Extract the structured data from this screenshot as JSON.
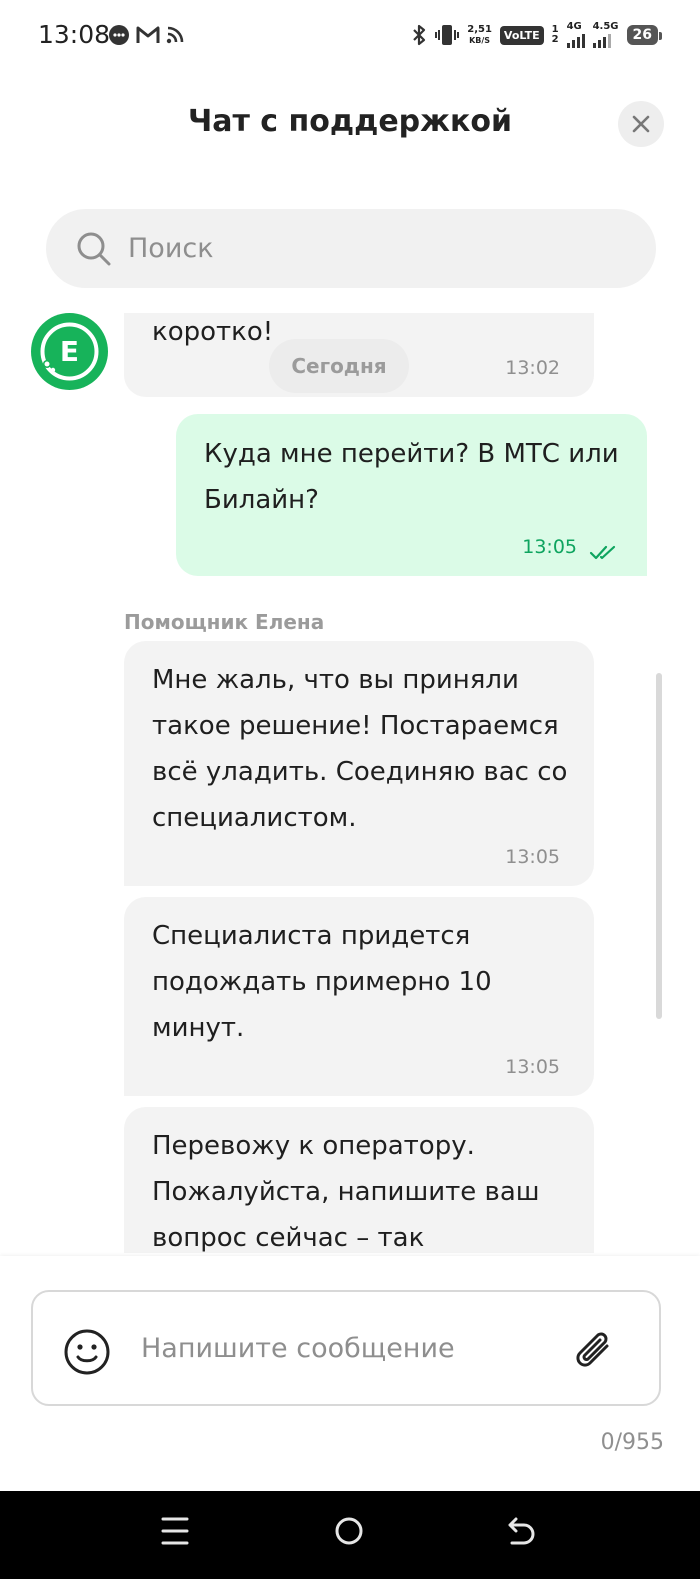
{
  "status_bar": {
    "time": "13:08",
    "speed_value": "2,51",
    "speed_unit": "KB/S",
    "volte": "VoLTE",
    "sim1": "1",
    "sim2": "2",
    "net1": "4G",
    "net2": "4.5G",
    "battery": "26"
  },
  "header": {
    "title": "Чат с поддержкой"
  },
  "search": {
    "placeholder": "Поиск"
  },
  "chat": {
    "avatar_letter": "E",
    "date_separator": "Сегодня",
    "sender_name": "Помощник Елена",
    "messages": [
      {
        "direction": "in",
        "text": "коротко!",
        "time": "13:02"
      },
      {
        "direction": "out",
        "text": "Куда мне перейти? В МТС или Билайн?",
        "time": "13:05"
      },
      {
        "direction": "in",
        "text": "Мне жаль, что вы приняли такое решение! Постараемся всё уладить. Соединяю вас со специалистом.",
        "time": "13:05"
      },
      {
        "direction": "in",
        "text": "Специалиста придется подождать примерно 10 минут.",
        "time": "13:05"
      },
      {
        "direction": "in",
        "text": "Перевожу к оператору. Пожалуйста, напишите ваш вопрос сейчас – так",
        "time": ""
      }
    ]
  },
  "composer": {
    "placeholder": "Напишите сообщение",
    "counter": "0/955"
  },
  "icons": {
    "close": "close-icon",
    "search": "search-icon",
    "emoji": "emoji-icon",
    "attach": "paperclip-icon",
    "read": "double-check-icon"
  },
  "colors": {
    "accent_green": "#17b35a",
    "outgoing_bubble": "#dbfbe7",
    "incoming_bubble": "#f3f3f3",
    "time_green": "#0ea45f"
  }
}
